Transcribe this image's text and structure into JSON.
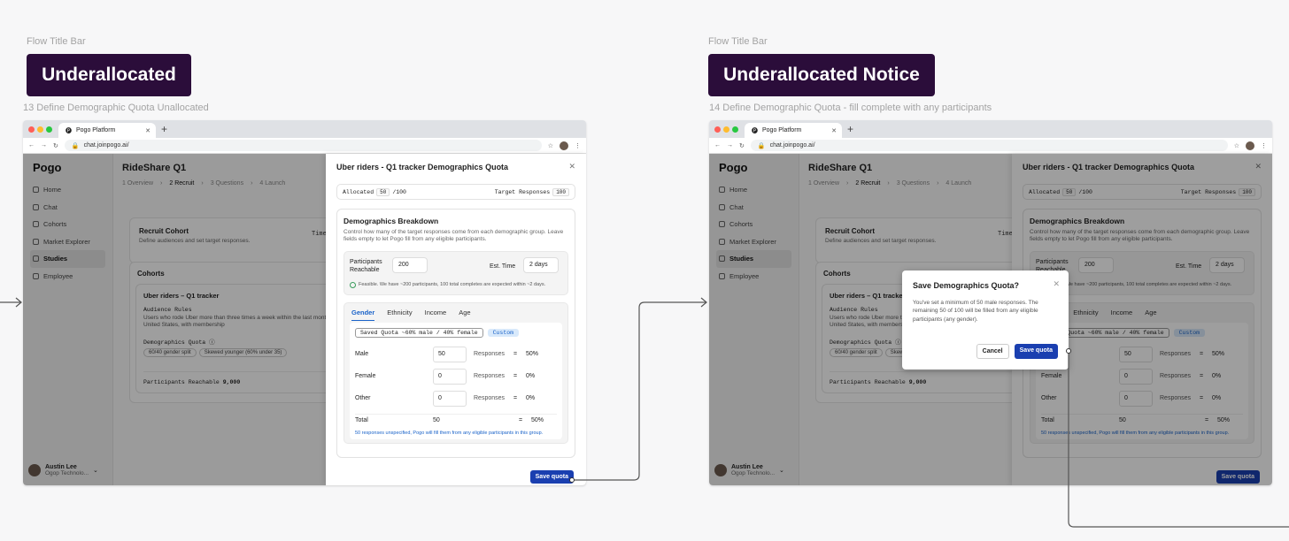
{
  "flows": [
    {
      "caption": "Flow Title Bar",
      "title": "Underallocated",
      "screen_label": "13 Define Demographic Quota Unallocated"
    },
    {
      "caption": "Flow Title Bar",
      "title": "Underallocated Notice",
      "screen_label": "14 Define Demographic Quota - fill complete with any participants"
    }
  ],
  "browser": {
    "tab": "Pogo Platform",
    "url": "chat.joinpogo.ai/"
  },
  "sidebar": {
    "logo": "Pogo",
    "items": [
      "Home",
      "Chat",
      "Cohorts",
      "Market Explorer",
      "Studies",
      "Employee"
    ],
    "user_name": "Austin Lee",
    "user_org": "Ogop Technolo..."
  },
  "page": {
    "title": "RideShare Q1",
    "steps": [
      "1 Overview",
      "2 Recruit",
      "3 Questions",
      "4 Launch"
    ],
    "recruit_title": "Recruit Cohort",
    "recruit_sub": "Define audiences and set target responses.",
    "time": "Time",
    "cohorts_title": "Cohorts",
    "cohort_name": "Uber riders – Q1 tracker",
    "audience_rules": "Audience Rules",
    "audience_desc": "Users who rode Uber more than three times a week within the last month, residing in the United States, with membership",
    "demo_quota": "Demographics Quota ⓘ",
    "chips": [
      "60/40 gender split",
      "Skewed younger (60% under 35)"
    ],
    "reachable_label": "Participants Reachable",
    "reachable_value": "9,000"
  },
  "panel": {
    "title": "Uber riders - Q1 tracker Demographics Quota",
    "allocated_label": "Allocated",
    "allocated": "50",
    "allocated_total": "/100",
    "target_label": "Target Responses",
    "target": "100",
    "breakdown_title": "Demographics Breakdown",
    "breakdown_desc": "Control how many of the target responses come from each demographic group. Leave fields empty to let Pogo fill from any eligible participants.",
    "reach_label": "Participants Reachable",
    "reach_value": "200",
    "est_label": "Est. Time",
    "est_value": "2 days",
    "feasible": "Feasible. We have ~200 participants, 100 total completes are expected within ~2 days.",
    "tabs": [
      "Gender",
      "Ethnicity",
      "Income",
      "Age"
    ],
    "saved_quota": "Saved Quota  ~60% male / 40% female",
    "custom": "Custom",
    "rows": [
      {
        "label": "Male",
        "value": "50",
        "pct": "50"
      },
      {
        "label": "Female",
        "value": "0",
        "pct": "0"
      },
      {
        "label": "Other",
        "value": "0",
        "pct": "0"
      }
    ],
    "responses": "Responses",
    "eq": "=",
    "pct_sign": "%",
    "total_label": "Total",
    "total": "50",
    "total_pct": "50",
    "unspecified": "50 responses unspecified, Pogo will fill them from any eligible participants in this group.",
    "save": "Save quota"
  },
  "dialog": {
    "title": "Save Demographics Quota?",
    "body": "You've set a minimum of 50 male responses. The remaining 50 of 100 will be filled from any eligible participants (any gender).",
    "cancel": "Cancel",
    "save": "Save quota"
  }
}
